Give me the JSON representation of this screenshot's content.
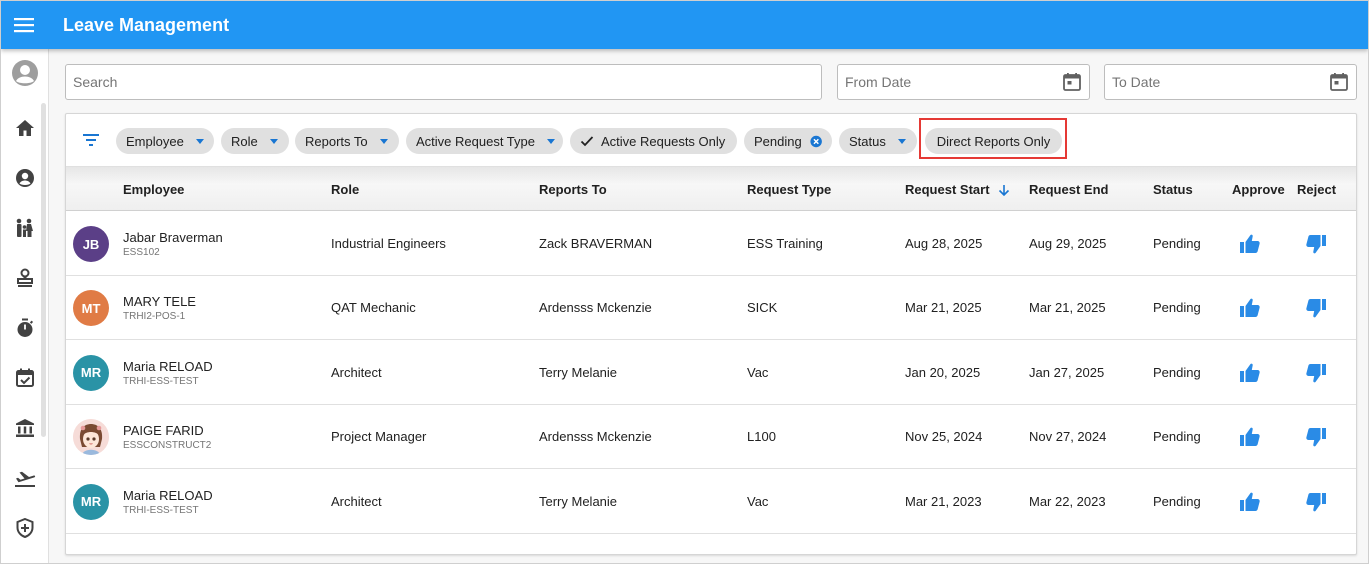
{
  "app": {
    "title": "Leave Management"
  },
  "search": {
    "placeholder": "Search"
  },
  "from_date": {
    "placeholder": "From Date"
  },
  "to_date": {
    "placeholder": "To Date"
  },
  "filters": [
    {
      "label": "Employee",
      "type": "dropdown"
    },
    {
      "label": "Role",
      "type": "dropdown"
    },
    {
      "label": "Reports To",
      "type": "dropdown"
    },
    {
      "label": "Active Request Type",
      "type": "dropdown"
    },
    {
      "label": "Active Requests Only",
      "type": "toggle-checked"
    },
    {
      "label": "Pending",
      "type": "removable"
    },
    {
      "label": "Status",
      "type": "dropdown"
    },
    {
      "label": "Direct Reports Only",
      "type": "toggle-highlighted"
    }
  ],
  "table": {
    "headers": {
      "employee": "Employee",
      "role": "Role",
      "reports_to": "Reports To",
      "request_type": "Request Type",
      "request_start": "Request Start",
      "request_end": "Request End",
      "status": "Status",
      "approve": "Approve",
      "reject": "Reject"
    },
    "rows": [
      {
        "initials": "JB",
        "avatar_color": "#5b3f87",
        "name": "Jabar Braverman",
        "id": "ESS102",
        "role": "Industrial Engineers",
        "reports_to": "Zack BRAVERMAN",
        "request_type": "ESS Training",
        "start": "Aug 28, 2025",
        "end": "Aug 29, 2025",
        "status": "Pending"
      },
      {
        "initials": "MT",
        "avatar_color": "#e07b45",
        "name": "MARY TELE",
        "id": "TRHI2-POS-1",
        "role": "QAT Mechanic",
        "reports_to": "Ardensss Mckenzie",
        "request_type": "SICK",
        "start": "Mar 21, 2025",
        "end": "Mar 21, 2025",
        "status": "Pending"
      },
      {
        "initials": "MR",
        "avatar_color": "#2a93a6",
        "name": "Maria RELOAD",
        "id": "TRHI-ESS-TEST",
        "role": "Architect",
        "reports_to": "Terry Melanie",
        "request_type": "Vac",
        "start": "Jan 20, 2025",
        "end": "Jan 27, 2025",
        "status": "Pending"
      },
      {
        "initials": "",
        "avatar_color": "#f6dcd8",
        "name": "PAIGE FARID",
        "id": "ESSCONSTRUCT2",
        "role": "Project Manager",
        "reports_to": "Ardensss Mckenzie",
        "request_type": "L100",
        "start": "Nov 25, 2024",
        "end": "Nov 27, 2024",
        "status": "Pending"
      },
      {
        "initials": "MR",
        "avatar_color": "#2a93a6",
        "name": "Maria RELOAD",
        "id": "TRHI-ESS-TEST",
        "role": "Architect",
        "reports_to": "Terry Melanie",
        "request_type": "Vac",
        "start": "Mar 21, 2023",
        "end": "Mar 22, 2023",
        "status": "Pending"
      }
    ]
  },
  "colors": {
    "primary": "#2196f3",
    "highlight": "#e53935"
  },
  "sidebar_icons": [
    "account-icon",
    "home-icon",
    "person-icon",
    "family-icon",
    "stamp-icon",
    "timer-icon",
    "calendar-check-icon",
    "bank-icon",
    "flight-icon",
    "shield-icon"
  ]
}
